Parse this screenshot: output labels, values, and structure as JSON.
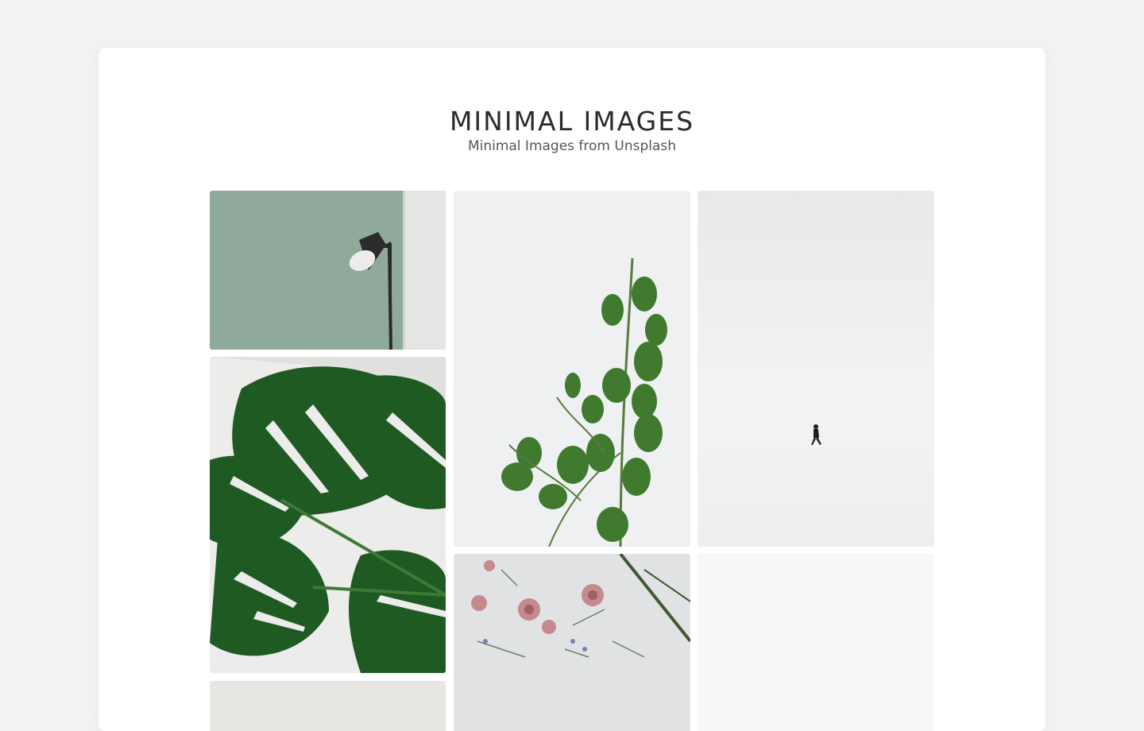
{
  "header": {
    "title": "MINIMAL IMAGES",
    "subtitle": "Minimal Images from Unsplash"
  },
  "gallery": {
    "images": [
      {
        "name": "lamp-on-green-wall"
      },
      {
        "name": "monstera-leaves"
      },
      {
        "name": "partial-grey-image"
      },
      {
        "name": "eucalyptus-branch"
      },
      {
        "name": "dried-flowers-flatlay"
      },
      {
        "name": "person-walking-in-snow"
      },
      {
        "name": "loading-placeholder"
      }
    ]
  },
  "colors": {
    "page_background": "#f2f2f2",
    "card_background": "#ffffff",
    "title": "#2b2b2b",
    "subtitle": "#555555"
  }
}
